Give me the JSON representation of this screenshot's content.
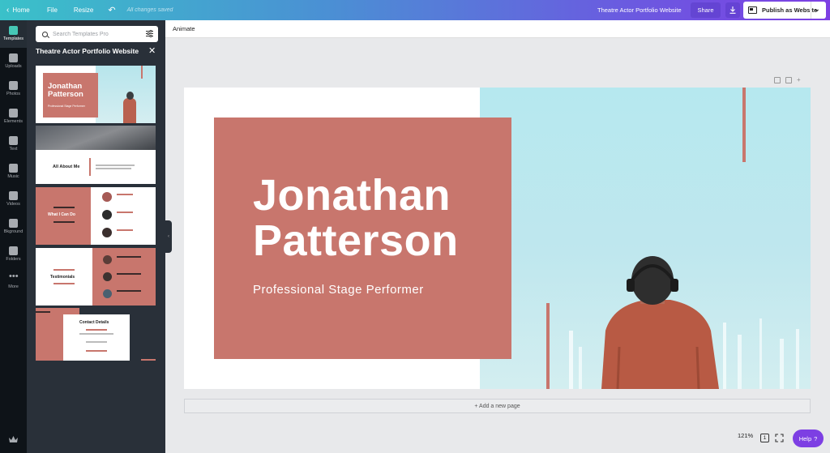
{
  "topbar": {
    "home_label": "Home",
    "file_label": "File",
    "resize_label": "Resize",
    "undo_icon": "undo-icon",
    "saved_status": "All changes saved",
    "design_title": "Theatre Actor Portfolio Website",
    "share_label": "Share",
    "publish_label": "Publish as Website",
    "gradient": [
      "#3ac1c9",
      "#4b8fd4",
      "#6a5be0",
      "#7d3fe3"
    ]
  },
  "rail": {
    "items": [
      {
        "label": "Templates",
        "icon": "templates-icon",
        "active": true
      },
      {
        "label": "Uploads",
        "icon": "uploads-icon"
      },
      {
        "label": "Photos",
        "icon": "photos-icon"
      },
      {
        "label": "Elements",
        "icon": "elements-icon"
      },
      {
        "label": "Text",
        "icon": "text-icon"
      },
      {
        "label": "Music",
        "icon": "music-icon"
      },
      {
        "label": "Videos",
        "icon": "videos-icon"
      },
      {
        "label": "Bkground",
        "icon": "background-icon"
      },
      {
        "label": "Folders",
        "icon": "folders-icon"
      },
      {
        "label": "More",
        "icon": "more-icon"
      }
    ]
  },
  "panel": {
    "search_placeholder": "Search Templates Pro",
    "title": "Theatre Actor Portfolio Website",
    "thumbnails": {
      "t1": {
        "name": "Jonathan Patterson",
        "sub": "Professional Stage Performer"
      },
      "t2": {
        "heading": "All About Me"
      },
      "t3": {
        "heading": "What I Can Do"
      },
      "t4": {
        "heading": "Testimonials"
      },
      "t5": {
        "heading": "Contact Details"
      }
    }
  },
  "subbar": {
    "animate_label": "Animate"
  },
  "canvas": {
    "name": "Jonathan Patterson",
    "name_line1": "Jonathan",
    "name_line2": "Patterson",
    "subtitle": "Professional Stage Performer",
    "accent_color": "#c8766d"
  },
  "add_page_label": "+ Add a new page",
  "zoom_label": "121%",
  "page_count": "1",
  "help_label": "Help",
  "help_icon": "?"
}
